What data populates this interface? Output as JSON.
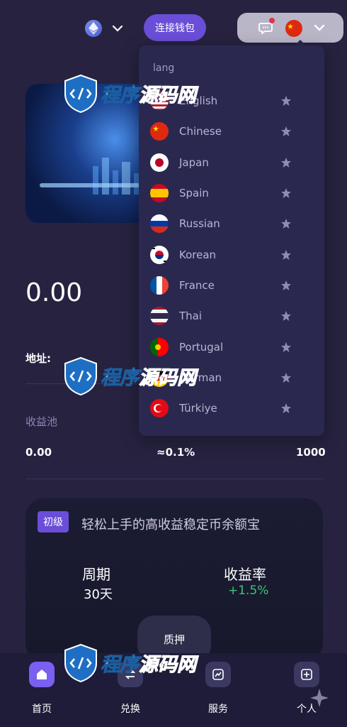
{
  "header": {
    "network_icon": "ethereum-icon",
    "connect_wallet_label": "连接钱包",
    "chat_icon": "chat-icon",
    "language_flag": "china-flag"
  },
  "banner": {
    "image": "city-network-illustration"
  },
  "wallet": {
    "balance": "0.00",
    "address_label": "地址:"
  },
  "pool": {
    "label": "收益池",
    "min": "0.00",
    "rate": "≈0.1%",
    "max": "1000"
  },
  "product": {
    "badge": "初级",
    "title": "轻松上手的高收益稳定币余额宝",
    "period_label": "周期",
    "period_value": "30天",
    "rate_label": "收益率",
    "rate_value": "+1.5%",
    "stake_label": "质押",
    "rate_color": "#3fc47a"
  },
  "language_menu": {
    "title": "lang",
    "items": [
      {
        "name": "English",
        "flag": "usa-flag"
      },
      {
        "name": "Chinese",
        "flag": "china-flag"
      },
      {
        "name": "Japan",
        "flag": "japan-flag"
      },
      {
        "name": "Spain",
        "flag": "spain-flag"
      },
      {
        "name": "Russian",
        "flag": "russia-flag"
      },
      {
        "name": "Korean",
        "flag": "korea-flag"
      },
      {
        "name": "France",
        "flag": "france-flag"
      },
      {
        "name": "Thai",
        "flag": "thailand-flag"
      },
      {
        "name": "Portugal",
        "flag": "portugal-flag"
      },
      {
        "name": "German",
        "flag": "germany-flag"
      },
      {
        "name": "Türkiye",
        "flag": "turkey-flag"
      }
    ]
  },
  "nav": {
    "items": [
      {
        "label": "首页",
        "icon": "home-icon",
        "active": true
      },
      {
        "label": "兑换",
        "icon": "swap-icon",
        "active": false
      },
      {
        "label": "服务",
        "icon": "service-icon",
        "active": false
      },
      {
        "label": "个人",
        "icon": "profile-icon",
        "active": false
      }
    ]
  },
  "watermark": {
    "text_a": "程序",
    "text_b": "源码网"
  },
  "colors": {
    "accent": "#6a4ed8",
    "background": "#262240",
    "positive": "#3fc47a"
  }
}
